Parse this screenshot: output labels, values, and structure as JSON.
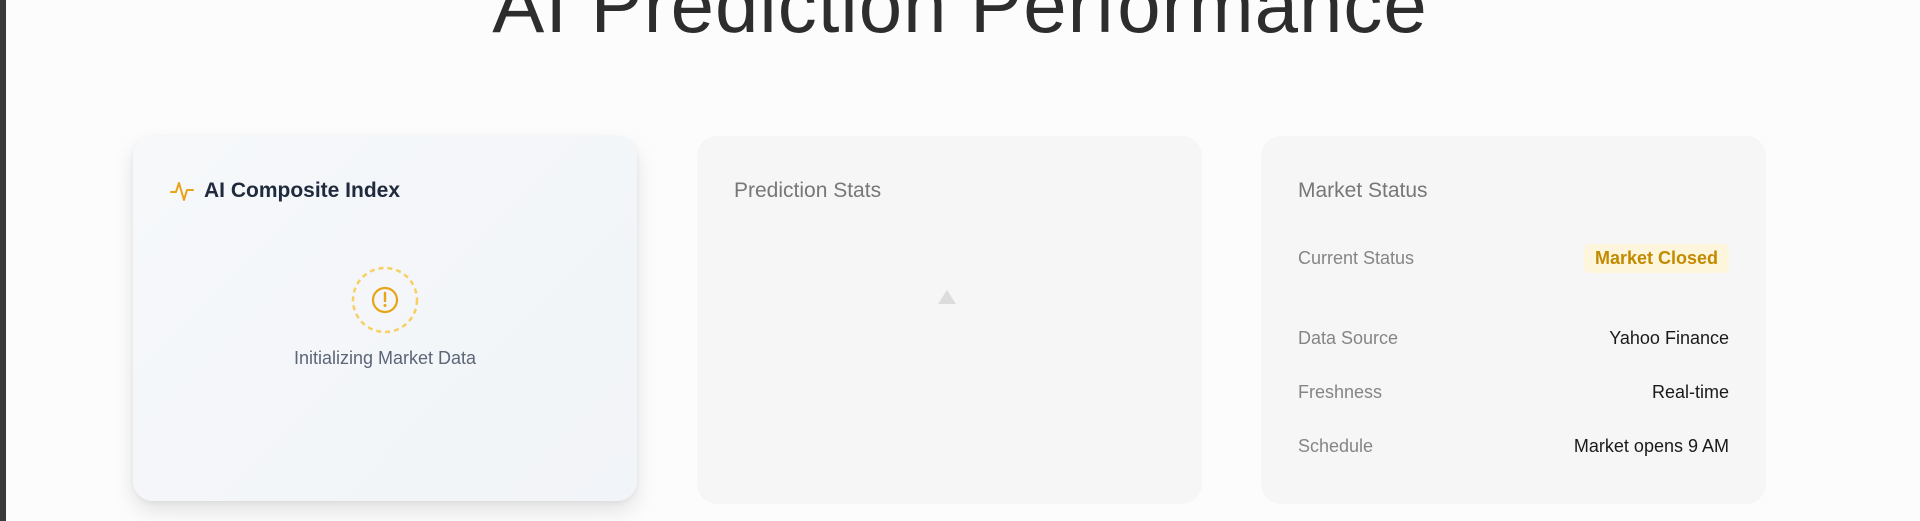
{
  "page": {
    "title": "AI Prediction Performance"
  },
  "ai_card": {
    "title": "AI Composite Index",
    "icon": "pulse-icon",
    "accent": "#e8a317",
    "loading_text": "Initializing Market Data",
    "loading_icon": "alert-circle-icon"
  },
  "prediction_card": {
    "title": "Prediction Stats"
  },
  "market_card": {
    "title": "Market Status",
    "rows": [
      {
        "label": "Current Status",
        "value": "Market Closed"
      },
      {
        "label": "Data Source",
        "value": "Yahoo Finance"
      },
      {
        "label": "Freshness",
        "value": "Real-time"
      },
      {
        "label": "Schedule",
        "value": "Market opens 9 AM"
      }
    ],
    "badge_color": "#c38a00"
  }
}
